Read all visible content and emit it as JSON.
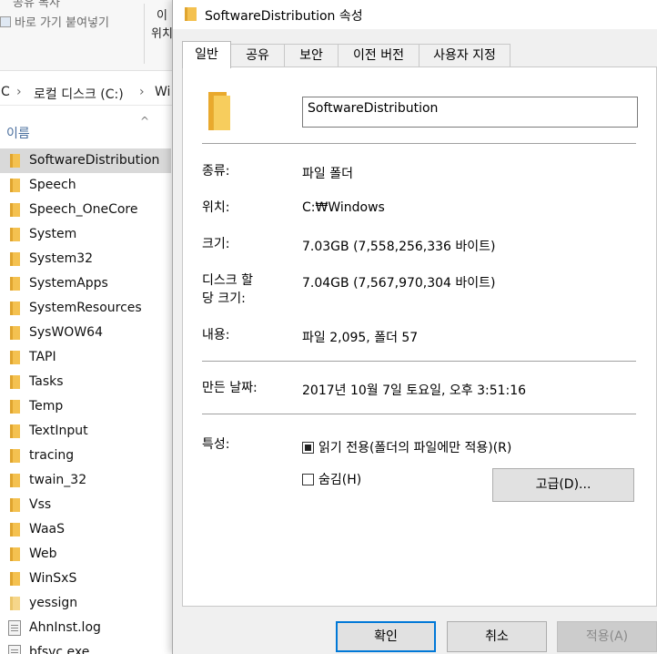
{
  "explorer": {
    "ribbon": {
      "top_cut_label": "공유 복사",
      "paste_shortcut_label": "바로 가기 붙여넣기",
      "move_label_1": "이",
      "move_label_2": "위치"
    },
    "address": {
      "prefix": "C",
      "sep": "›",
      "drive": "로컬 디스크 (C:)",
      "next": "Wi"
    },
    "column_name": "이름",
    "sort_glyph": "^",
    "files": [
      {
        "name": "SoftwareDistribution",
        "type": "folder",
        "selected": true
      },
      {
        "name": "Speech",
        "type": "folder"
      },
      {
        "name": "Speech_OneCore",
        "type": "folder"
      },
      {
        "name": "System",
        "type": "folder"
      },
      {
        "name": "System32",
        "type": "folder"
      },
      {
        "name": "SystemApps",
        "type": "folder"
      },
      {
        "name": "SystemResources",
        "type": "folder"
      },
      {
        "name": "SysWOW64",
        "type": "folder"
      },
      {
        "name": "TAPI",
        "type": "folder"
      },
      {
        "name": "Tasks",
        "type": "folder"
      },
      {
        "name": "Temp",
        "type": "folder"
      },
      {
        "name": "TextInput",
        "type": "folder"
      },
      {
        "name": "tracing",
        "type": "folder"
      },
      {
        "name": "twain_32",
        "type": "folder"
      },
      {
        "name": "Vss",
        "type": "folder"
      },
      {
        "name": "WaaS",
        "type": "folder"
      },
      {
        "name": "Web",
        "type": "folder"
      },
      {
        "name": "WinSxS",
        "type": "folder"
      },
      {
        "name": "yessign",
        "type": "folder-light"
      },
      {
        "name": "AhnInst.log",
        "type": "file"
      },
      {
        "name": "bfsvc.exe",
        "type": "file"
      }
    ]
  },
  "dialog": {
    "title": "SoftwareDistribution 속성",
    "tabs": [
      {
        "label": "일반",
        "active": true
      },
      {
        "label": "공유"
      },
      {
        "label": "보안"
      },
      {
        "label": "이전 버전"
      },
      {
        "label": "사용자 지정"
      }
    ],
    "folder_name": "SoftwareDistribution",
    "fields": {
      "type_label": "종류:",
      "type_value": "파일 폴더",
      "location_label": "위치:",
      "location_value": "C:₩Windows",
      "size_label": "크기:",
      "size_value": "7.03GB (7,558,256,336 바이트)",
      "disk_size_label_1": "디스크 할",
      "disk_size_label_2": "당 크기:",
      "disk_size_value": "7.04GB (7,567,970,304 바이트)",
      "contents_label": "내용:",
      "contents_value": "파일 2,095, 폴더 57",
      "created_label": "만든 날짜:",
      "created_value": "2017년 10월 7일 토요일, 오후 3:51:16",
      "attributes_label": "특성:"
    },
    "attributes": {
      "readonly_label": "읽기 전용(폴더의 파일에만 적용)(R)",
      "readonly_state": "indeterminate",
      "hidden_label": "숨김(H)",
      "hidden_state": "unchecked",
      "advanced_label": "고급(D)..."
    },
    "buttons": {
      "ok": "확인",
      "cancel": "취소",
      "apply": "적용(A)"
    }
  }
}
